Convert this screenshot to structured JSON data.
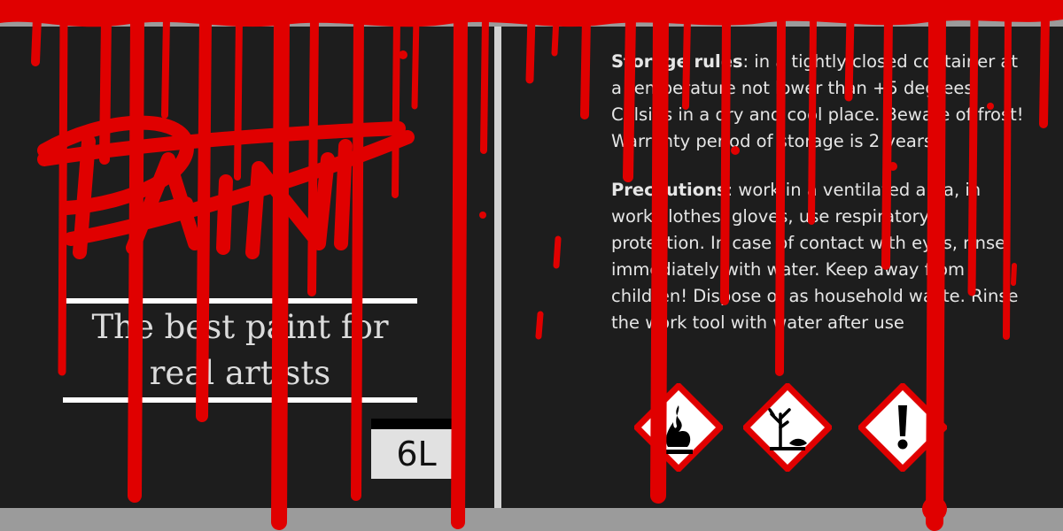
{
  "logo": {
    "text": "PAINT"
  },
  "tagline": {
    "text": "The best paint for\nreal artists"
  },
  "volume": {
    "label": "6L"
  },
  "storage": {
    "heading": "Storage rules",
    "body": ": in a tightly closed container at a temperature not lower than +5 degrees Celsius in a dry and cool place. Beware of frost! Warranty period of storage is 2 years."
  },
  "precautions": {
    "heading": "Precautions",
    "body": ": work in a ventilated area, in work clothes, gloves, use respiratory protection. In case of contact with eyes, rinse immediately with water. Keep away from children! Dispose of as household waste. Rinse the work tool with water after use"
  },
  "hazards": [
    "flame-icon",
    "environment-hazard-icon",
    "exclamation-icon"
  ],
  "colors": {
    "background": "#1d1d1d",
    "frame": "#9b9b9b",
    "paint_red": "#e00000",
    "text": "#e6e6e6",
    "divider": "#d2d2d2"
  }
}
